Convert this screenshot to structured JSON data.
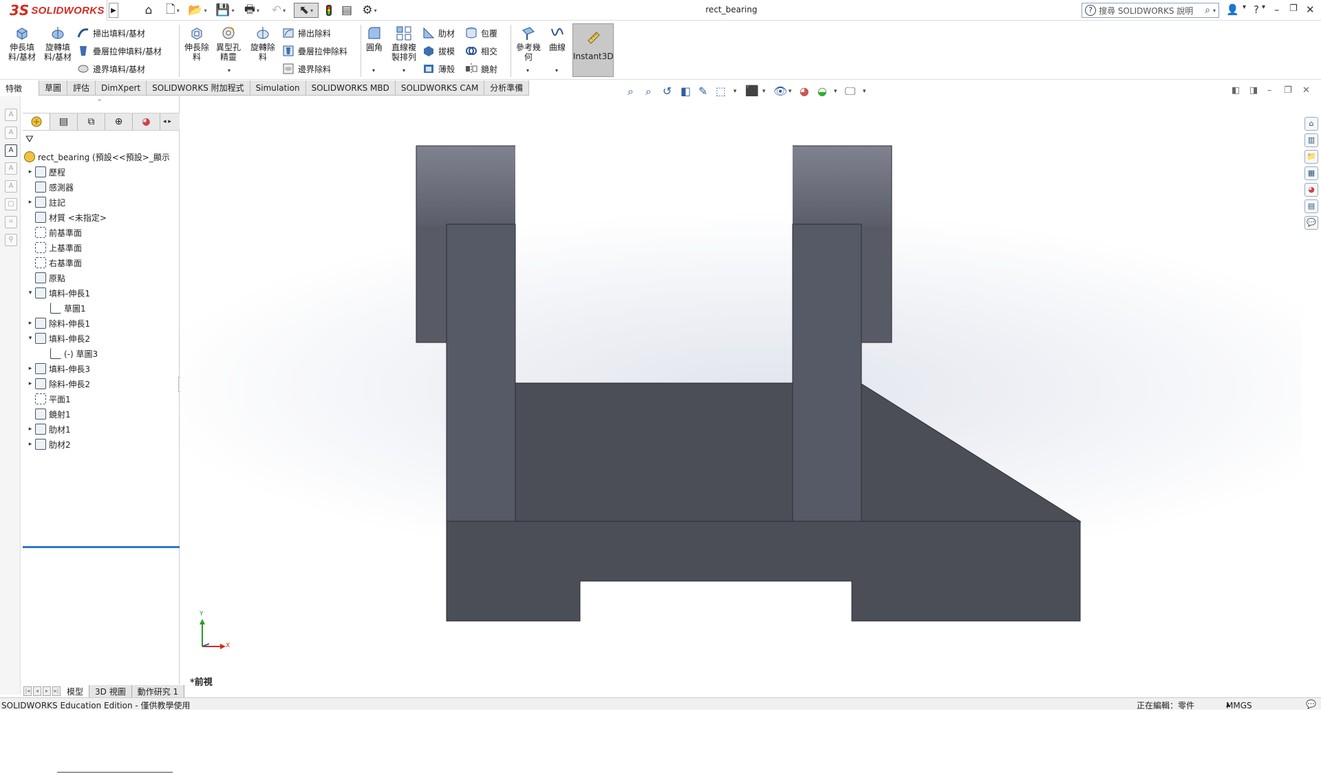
{
  "app": {
    "brand_mark": "3S",
    "brand_name": "SOLIDWORKS",
    "window_title": "rect_bearing",
    "search_placeholder": "搜尋 SOLIDWORKS 說明"
  },
  "ribbon": {
    "extrude_boss": "伸長填料/基材",
    "revolve_boss": "旋轉填料/基材",
    "sweep_boss": "掃出填料/基材",
    "loft_boss": "疊層拉伸填料/基材",
    "boundary_boss": "邊界填料/基材",
    "extrude_cut": "伸長除料",
    "hole_wizard": "異型孔精靈",
    "revolve_cut": "旋轉除料",
    "sweep_cut": "掃出除料",
    "loft_cut": "疊層拉伸除料",
    "boundary_cut": "邊界除料",
    "fillet": "圓角",
    "linear_pattern": "直線複製排列",
    "rib": "肋材",
    "wrap": "包覆",
    "draft": "拔模",
    "intersect": "相交",
    "shell": "薄殼",
    "mirror": "鏡射",
    "ref_geometry": "參考幾何",
    "curves": "曲線",
    "instant3d": "Instant3D"
  },
  "tabs": [
    "特徵",
    "草圖",
    "評估",
    "DimXpert",
    "SOLIDWORKS 附加程式",
    "Simulation",
    "SOLIDWORKS MBD",
    "SOLIDWORKS CAM",
    "分析準備"
  ],
  "tree": {
    "root": "rect_bearing  (預設<<預設>_顯示",
    "items": [
      {
        "label": "歷程",
        "expand": "▸",
        "icon": "history"
      },
      {
        "label": "感測器",
        "expand": "",
        "icon": "sensor"
      },
      {
        "label": "註記",
        "expand": "▸",
        "icon": "annotation"
      },
      {
        "label": "材質 <未指定>",
        "expand": "",
        "icon": "material"
      },
      {
        "label": "前基準面",
        "expand": "",
        "icon": "plane"
      },
      {
        "label": "上基準面",
        "expand": "",
        "icon": "plane"
      },
      {
        "label": "右基準面",
        "expand": "",
        "icon": "plane"
      },
      {
        "label": "原點",
        "expand": "",
        "icon": "origin"
      },
      {
        "label": "填料-伸長1",
        "expand": "▾",
        "icon": "feature"
      },
      {
        "label": "草圖1",
        "expand": "",
        "icon": "sketch",
        "indent": 1
      },
      {
        "label": "除料-伸長1",
        "expand": "▸",
        "icon": "feature"
      },
      {
        "label": "填料-伸長2",
        "expand": "▾",
        "icon": "feature"
      },
      {
        "label": "(-) 草圖3",
        "expand": "",
        "icon": "sketch",
        "indent": 1
      },
      {
        "label": "填料-伸長3",
        "expand": "▸",
        "icon": "feature"
      },
      {
        "label": "除料-伸長2",
        "expand": "▸",
        "icon": "feature"
      },
      {
        "label": "平面1",
        "expand": "",
        "icon": "plane"
      },
      {
        "label": "鏡射1",
        "expand": "",
        "icon": "feature"
      },
      {
        "label": "肋材1",
        "expand": "▸",
        "icon": "feature"
      },
      {
        "label": "肋材2",
        "expand": "▸",
        "icon": "feature"
      }
    ]
  },
  "bottom_tabs": [
    "模型",
    "3D 視圖",
    "動作研究 1"
  ],
  "viewport": {
    "view_name": "*前視",
    "triad_y": "Y",
    "triad_x": "X"
  },
  "status": {
    "edition": "SOLIDWORKS Education Edition - 僅供教學使用",
    "editing": "正在編輯：零件",
    "units": "MMGS"
  },
  "colors": {
    "model_dark": "#4b4d57",
    "model_mid": "#565a66",
    "brand_red": "#d52b1e",
    "tree_accent": "#2f77c4"
  }
}
